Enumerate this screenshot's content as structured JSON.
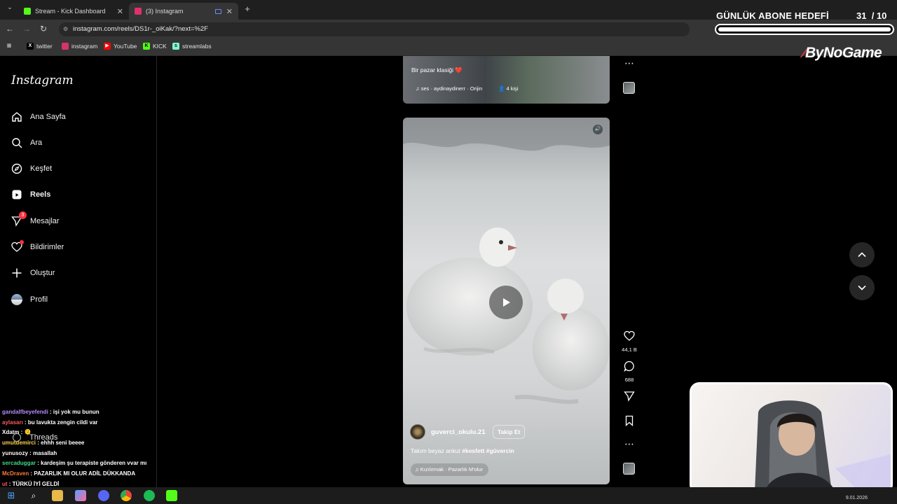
{
  "browser": {
    "tabs": [
      {
        "title": "Stream - Kick Dashboard",
        "active": false,
        "color": "#53fc18"
      },
      {
        "title": "(3) Instagram",
        "active": true,
        "color": "#e1306c"
      }
    ],
    "url": "instagram.com/reels/DS1r-_oiKak/?next=%2F",
    "bookmarks": [
      {
        "label": "twitter",
        "icon": "x-icon"
      },
      {
        "label": "instagram",
        "icon": "instagram-icon"
      },
      {
        "label": "YouTube",
        "icon": "youtube-icon"
      },
      {
        "label": "KICK",
        "icon": "kick-icon"
      },
      {
        "label": "streamlabs",
        "icon": "streamlabs-icon"
      }
    ]
  },
  "overlay": {
    "goal_title": "GÜNLÜK ABONE HEDEFİ",
    "goal_current": "31",
    "goal_total": "/ 10",
    "goal_progress": 1.0,
    "brand": "ByNoGame"
  },
  "sidebar": {
    "logo": "Instagram",
    "items": [
      {
        "label": "Ana Sayfa",
        "icon": "home-icon",
        "bold": false
      },
      {
        "label": "Ara",
        "icon": "search-icon",
        "bold": false
      },
      {
        "label": "Keşfet",
        "icon": "compass-icon",
        "bold": false
      },
      {
        "label": "Reels",
        "icon": "reels-icon",
        "bold": true
      },
      {
        "label": "Mesajlar",
        "icon": "messages-icon",
        "bold": false,
        "badge": "3"
      },
      {
        "label": "Bildirimler",
        "icon": "heart-icon",
        "bold": false,
        "dot": true
      },
      {
        "label": "Oluştur",
        "icon": "plus-icon",
        "bold": false
      },
      {
        "label": "Profil",
        "icon": "avatar",
        "bold": false
      }
    ],
    "threads": "Threads"
  },
  "chat": [
    {
      "user": "gandalfbeyefendi",
      "msg": ": işi yok mu bunun",
      "color": "#b58cff"
    },
    {
      "user": "aylasarı",
      "msg": ": bu lavukta zengin cildi var",
      "color": "#ff5a5a"
    },
    {
      "user": "Xdatm",
      "msg": ": 🫠",
      "color": "#ffffff"
    },
    {
      "user": "umutdemirci",
      "msg": ": ehhh seni beeee",
      "color": "#ffd24a"
    },
    {
      "user": "yunusozy",
      "msg": ": masallah",
      "color": "#ffffff"
    },
    {
      "user": "sercaduggar",
      "msg": ": kardeşim şu terapiste gönderen vvar mı",
      "color": "#3ddc84"
    },
    {
      "user": "McDraven",
      "msg": ": PAZARLIK MI OLUR ADİL DÜKKANDA",
      "color": "#ff7a3a"
    },
    {
      "user": "ut",
      "msg": ": TÜRKÜ İYİ GELDİ",
      "color": "#ff5a5a"
    }
  ],
  "reel_prev": {
    "caption": "Bir pazar klasiği ❤️",
    "audio": "ses · aydinaydinerr · Orijin",
    "people": "4 kişi"
  },
  "reel": {
    "username": "guverci_okulu.21",
    "follow": "Takip Et",
    "caption_text": "Takım beyaz ankut ",
    "hashtags": "#kesfett #güvercin",
    "audio": "Kızılırmak · Pazarlık M'olur",
    "likes": "44,1 B",
    "comments": "688"
  },
  "taskbar": {
    "date": "9.01.2026"
  }
}
